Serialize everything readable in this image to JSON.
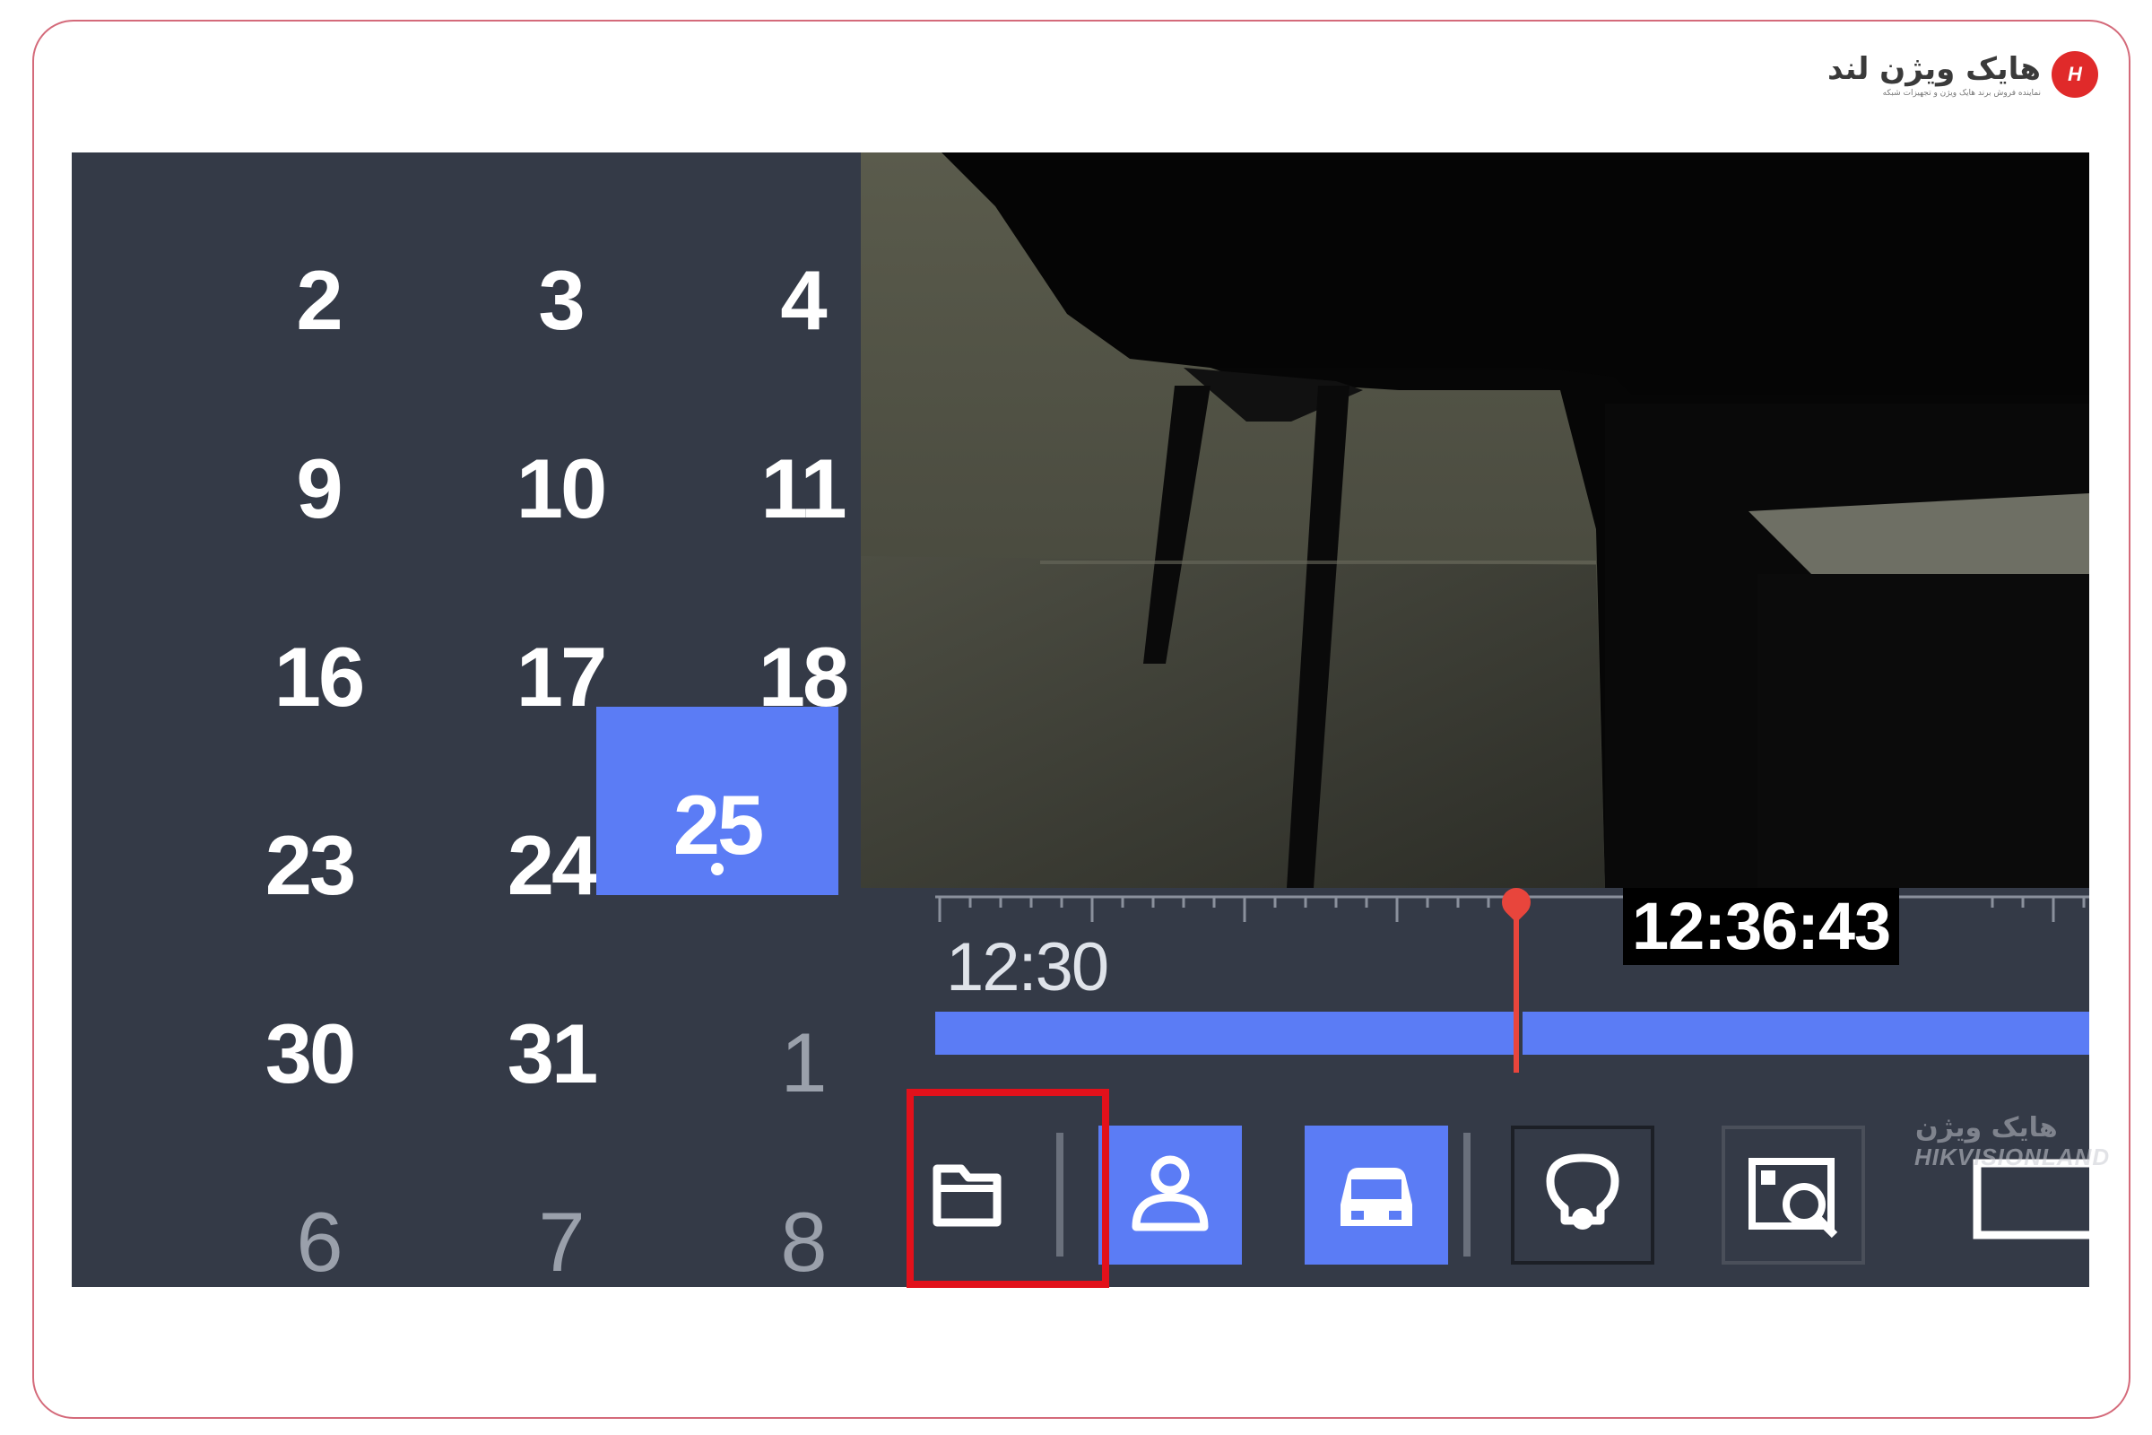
{
  "branding": {
    "logo_text": "هایک ویژن لند",
    "logo_tagline": "نماینده فروش برند هایک ویژن و تجهیزات شبکه",
    "logo_mark": "H",
    "watermark_text": "HIKVISIONLAND",
    "watermark_fa": "هایک ویژن"
  },
  "calendar": {
    "selected_day": "25",
    "rows": [
      [
        "2",
        "3",
        "4"
      ],
      [
        "9",
        "10",
        "11"
      ],
      [
        "16",
        "17",
        "18"
      ],
      [
        "23",
        "24",
        "25"
      ],
      [
        "30",
        "31",
        "1"
      ],
      [
        "6",
        "7",
        "8"
      ]
    ]
  },
  "timeline": {
    "start_label": "12:30",
    "current_time": "12:36:43",
    "playhead_progress": 0.374
  },
  "toolbar": {
    "buttons": [
      {
        "name": "folder",
        "icon": "folder-icon",
        "active": false
      },
      {
        "name": "human",
        "icon": "person-icon",
        "active": true
      },
      {
        "name": "vehicle",
        "icon": "car-icon",
        "active": true
      },
      {
        "name": "smart",
        "icon": "lightbulb-icon",
        "active": false
      },
      {
        "name": "search",
        "icon": "image-search-icon",
        "active": false
      },
      {
        "name": "more",
        "icon": "square-icon",
        "active": false
      }
    ]
  },
  "colors": {
    "panel": "#343a47",
    "accent": "#5b7cf5",
    "playhead": "#e8453c",
    "highlight": "#e2111b"
  }
}
